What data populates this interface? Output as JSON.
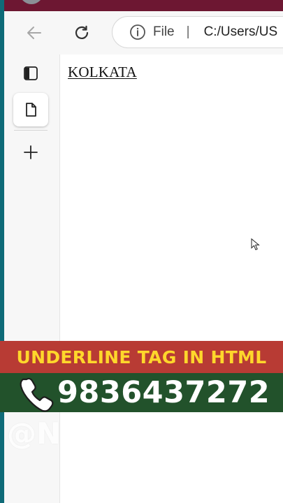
{
  "browser": {
    "address_bar": {
      "scheme_label": "File",
      "separator": "|",
      "url": "C:/Users/US"
    },
    "icons": {
      "back": "back-arrow-icon",
      "reload": "reload-icon",
      "info": "info-icon",
      "tab_actions": "tab-actions-icon",
      "page": "page-icon",
      "new_tab": "plus-icon"
    }
  },
  "document": {
    "underlined_text": "KOLKATA"
  },
  "overlay": {
    "banner_title": "UNDERLINE TAG IN HTML",
    "phone_number": "9836437272",
    "watermark": "@N"
  },
  "colors": {
    "title_bar": "#6d1732",
    "left_strip": "#0f6b78",
    "banner_red": "#b83b34",
    "banner_text": "#ffd72b",
    "banner_green": "#22522b"
  }
}
